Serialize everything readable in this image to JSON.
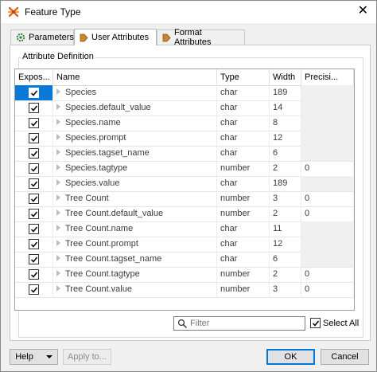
{
  "window": {
    "title": "Feature Type",
    "close_glyph": "✕"
  },
  "tabs": [
    {
      "label": "Parameters",
      "icon": "gear-icon"
    },
    {
      "label": "User Attributes",
      "icon": "attribute-arrow-icon"
    },
    {
      "label": "Format Attributes",
      "icon": "attribute-arrow-icon"
    }
  ],
  "group": {
    "label": "Attribute Definition"
  },
  "table": {
    "headers": [
      "Expos...",
      "Name",
      "Type",
      "Width",
      "Precisi..."
    ],
    "rows": [
      {
        "exposed": true,
        "name": "Species",
        "type": "char",
        "width": "189",
        "precision": ""
      },
      {
        "exposed": true,
        "name": "Species.default_value",
        "type": "char",
        "width": "14",
        "precision": ""
      },
      {
        "exposed": true,
        "name": "Species.name",
        "type": "char",
        "width": "8",
        "precision": ""
      },
      {
        "exposed": true,
        "name": "Species.prompt",
        "type": "char",
        "width": "12",
        "precision": ""
      },
      {
        "exposed": true,
        "name": "Species.tagset_name",
        "type": "char",
        "width": "6",
        "precision": ""
      },
      {
        "exposed": true,
        "name": "Species.tagtype",
        "type": "number",
        "width": "2",
        "precision": "0"
      },
      {
        "exposed": true,
        "name": "Species.value",
        "type": "char",
        "width": "189",
        "precision": ""
      },
      {
        "exposed": true,
        "name": "Tree Count",
        "type": "number",
        "width": "3",
        "precision": "0"
      },
      {
        "exposed": true,
        "name": "Tree Count.default_value",
        "type": "number",
        "width": "2",
        "precision": "0"
      },
      {
        "exposed": true,
        "name": "Tree Count.name",
        "type": "char",
        "width": "11",
        "precision": ""
      },
      {
        "exposed": true,
        "name": "Tree Count.prompt",
        "type": "char",
        "width": "12",
        "precision": ""
      },
      {
        "exposed": true,
        "name": "Tree Count.tagset_name",
        "type": "char",
        "width": "6",
        "precision": ""
      },
      {
        "exposed": true,
        "name": "Tree Count.tagtype",
        "type": "number",
        "width": "2",
        "precision": "0"
      },
      {
        "exposed": true,
        "name": "Tree Count.value",
        "type": "number",
        "width": "3",
        "precision": "0"
      }
    ]
  },
  "filter": {
    "placeholder": "Filter",
    "value": ""
  },
  "select_all": {
    "label": "Select All",
    "checked": true
  },
  "buttons": {
    "help": "Help",
    "apply": "Apply to...",
    "ok": "OK",
    "cancel": "Cancel"
  },
  "colors": {
    "selection": "#0a78d7",
    "primary_border": "#0078d7",
    "tab_icon": "#c8862a",
    "gear": "#2e7d32"
  }
}
